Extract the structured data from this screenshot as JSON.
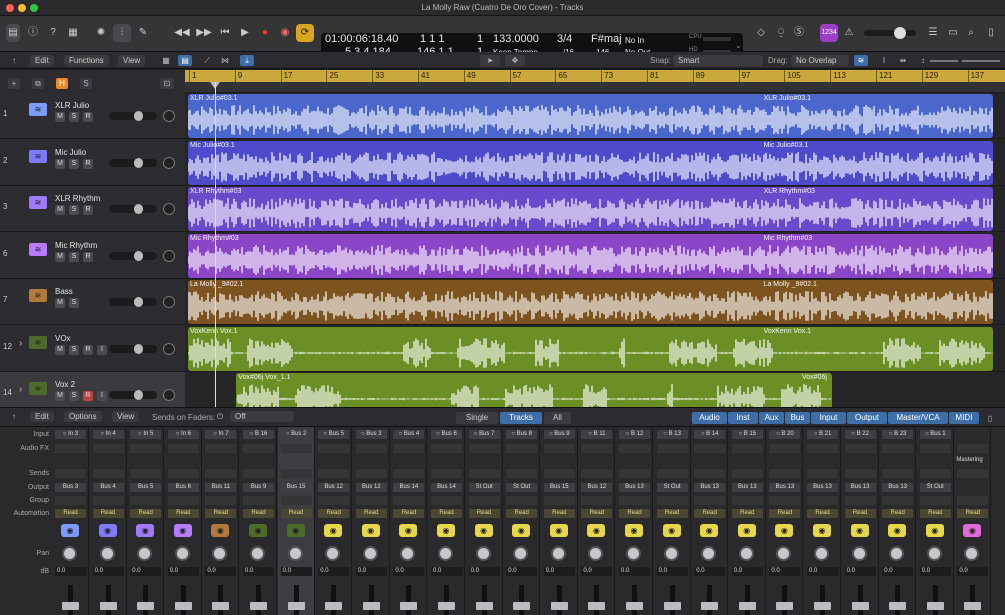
{
  "window": {
    "title": "La Molly Raw (Cuatro De Oro Cover) - Tracks"
  },
  "lcd": {
    "time": "01:00:06:18.40",
    "time_bars": "1  1  1",
    "time_sub": "1",
    "position": "5  3  4  184",
    "bars": "146  1  1",
    "bars_sub": "1",
    "tempo": "133.0000",
    "tempo_mode": "Keep Tempo",
    "signature": "3/4",
    "division": "/16",
    "key": "F#maj",
    "key_num": "146",
    "in": "No In",
    "out": "No Out",
    "cpu": "CPU",
    "hd": "HD"
  },
  "control": {
    "count_in": "1234"
  },
  "trackbar": {
    "edit": "Edit",
    "functions": "Functions",
    "view": "View",
    "snap_label": "Snap:",
    "snap": "Smart",
    "drag_label": "Drag:",
    "drag": "No Overlap"
  },
  "ruler": [
    "1",
    "9",
    "17",
    "25",
    "33",
    "41",
    "49",
    "57",
    "65",
    "73",
    "81",
    "89",
    "97",
    "105",
    "113",
    "121",
    "129",
    "137"
  ],
  "tracks": [
    {
      "num": "1",
      "name": "XLR Julio",
      "color": "#4b66cc",
      "icon": "#7a9aff",
      "m": "M",
      "s": "S",
      "r": "R",
      "i": "",
      "slider": 0.62,
      "regions": [
        {
          "name": "XLR Julio#03.1",
          "start": 0,
          "end": 1,
          "tail": "XLR Julio#03.1"
        }
      ]
    },
    {
      "num": "2",
      "name": "Mic Julio",
      "color": "#4d4bcc",
      "icon": "#7f79ff",
      "m": "M",
      "s": "S",
      "r": "R",
      "i": "",
      "slider": 0.62,
      "regions": [
        {
          "name": "Mic Julio#03.1",
          "start": 0,
          "end": 1,
          "tail": "Mic Julio#03.1"
        }
      ]
    },
    {
      "num": "3",
      "name": "XLR Rhythm",
      "color": "#6b49cc",
      "icon": "#9f7aff",
      "m": "M",
      "s": "S",
      "r": "R",
      "i": "",
      "slider": 0.62,
      "regions": [
        {
          "name": "XLR Rhythm#03",
          "start": 0,
          "end": 1,
          "tail": "XLR Rhythm#03"
        }
      ]
    },
    {
      "num": "6",
      "name": "Mic Rhythm",
      "color": "#8a45c9",
      "icon": "#b87aff",
      "m": "M",
      "s": "S",
      "r": "R",
      "i": "",
      "slider": 0.62,
      "regions": [
        {
          "name": "Mic Rhythm#03",
          "start": 0,
          "end": 1,
          "tail": "Mic Rhythm#03"
        }
      ]
    },
    {
      "num": "7",
      "name": "Bass",
      "color": "#7d5420",
      "icon": "#b07a3a",
      "m": "M",
      "s": "S",
      "r": "",
      "i": "",
      "slider": 0.62,
      "regions": [
        {
          "name": "La Molly _9#02.1",
          "start": 0,
          "end": 1,
          "tail": "La Molly _9#02.1"
        }
      ]
    },
    {
      "num": "12",
      "name": "VOx",
      "color": "#6b8f25",
      "icon": "#4d6b2a",
      "m": "M",
      "s": "S",
      "r": "R",
      "i": "I",
      "slider": 0.62,
      "folder": true,
      "regions": [
        {
          "name": "VoxKenn Vox.1",
          "start": 0,
          "end": 1,
          "tail": "VoxKenn Vox.1"
        }
      ]
    },
    {
      "num": "14",
      "name": "Vox 2",
      "color": "#6b8f25",
      "icon": "#4d6b2a",
      "m": "M",
      "s": "S",
      "r": "R",
      "i": "I",
      "slider": 0.62,
      "folder": true,
      "selected": true,
      "regions": [
        {
          "name": "Vox#06j Vox_1.1",
          "start": 0.06,
          "end": 0.8,
          "tail": "Vox#06j"
        }
      ]
    }
  ],
  "mixerbar": {
    "edit": "Edit",
    "options": "Options",
    "view": "View",
    "sends_on_faders": "Sends on Faders:",
    "sends_value": "Off",
    "modes": [
      "Single",
      "Tracks",
      "All"
    ],
    "active_mode": "Tracks",
    "filters": [
      "Audio",
      "Inst",
      "Aux",
      "Bus",
      "Input",
      "Output",
      "Master/VCA",
      "MIDI"
    ]
  },
  "mixer": {
    "row_labels": [
      "Input",
      "Audio FX",
      "Sends",
      "Output",
      "Group",
      "Automation",
      "Pan",
      "dB"
    ],
    "strips": [
      {
        "input": "In 3",
        "output": "Bus 3",
        "auto": "Read",
        "icon": "#7a9aff",
        "db": "0.0"
      },
      {
        "input": "In 4",
        "output": "Bus 4",
        "auto": "Read",
        "icon": "#7f79ff",
        "db": "0.0"
      },
      {
        "input": "In 5",
        "output": "Bus 5",
        "auto": "Read",
        "icon": "#9f7aff",
        "db": "0.0"
      },
      {
        "input": "In 6",
        "output": "Bus 6",
        "auto": "Read",
        "icon": "#b87aff",
        "db": "0.0"
      },
      {
        "input": "In 7",
        "output": "Bus 11",
        "auto": "Read",
        "icon": "#b07a3a",
        "db": "0.0"
      },
      {
        "input": "B 16",
        "output": "Bus 9",
        "auto": "Read",
        "icon": "#4d6b2a",
        "db": "0.0"
      },
      {
        "input": "Bus 2",
        "output": "Bus 15",
        "auto": "Read",
        "icon": "#4d6b2a",
        "db": "0.0",
        "selected": true
      },
      {
        "input": "Bus 5",
        "output": "Bus 12",
        "auto": "Read",
        "icon": "#e6d84a",
        "db": "0.0"
      },
      {
        "input": "Bus 3",
        "output": "Bus 12",
        "auto": "Read",
        "icon": "#e6d84a",
        "db": "0.0"
      },
      {
        "input": "Bus 4",
        "output": "Bus 14",
        "auto": "Read",
        "icon": "#e6d84a",
        "db": "0.0"
      },
      {
        "input": "Bus 6",
        "output": "Bus 14",
        "auto": "Read",
        "icon": "#e6d84a",
        "db": "0.0"
      },
      {
        "input": "Bus 7",
        "output": "St Out",
        "auto": "Read",
        "icon": "#e6d84a",
        "db": "0.0"
      },
      {
        "input": "Bus 8",
        "output": "St Out",
        "auto": "Read",
        "icon": "#e6d84a",
        "db": "0.0"
      },
      {
        "input": "Bus 9",
        "output": "Bus 15",
        "auto": "Read",
        "icon": "#e6d84a",
        "db": "0.0"
      },
      {
        "input": "B 11",
        "output": "Bus 12",
        "auto": "Read",
        "icon": "#e6d84a",
        "db": "0.0"
      },
      {
        "input": "B 12",
        "output": "Bus 13",
        "auto": "Read",
        "icon": "#e6d84a",
        "db": "0.0"
      },
      {
        "input": "B 13",
        "output": "St Out",
        "auto": "Read",
        "icon": "#e6d84a",
        "db": "0.0"
      },
      {
        "input": "B 14",
        "output": "Bus 13",
        "auto": "Read",
        "icon": "#e6d84a",
        "db": "0.0"
      },
      {
        "input": "B 15",
        "output": "Bus 13",
        "auto": "Read",
        "icon": "#e6d84a",
        "db": "0.0"
      },
      {
        "input": "B 20",
        "output": "Bus 13",
        "auto": "Read",
        "icon": "#e6d84a",
        "db": "0.0"
      },
      {
        "input": "B 21",
        "output": "Bus 13",
        "auto": "Read",
        "icon": "#e6d84a",
        "db": "0.0"
      },
      {
        "input": "B 22",
        "output": "Bus 13",
        "auto": "Read",
        "icon": "#e6d84a",
        "db": "0.0"
      },
      {
        "input": "B 23",
        "output": "Bus 13",
        "auto": "Read",
        "icon": "#e6d84a",
        "db": "0.0"
      },
      {
        "input": "Bus 1",
        "output": "St Out",
        "auto": "Read",
        "icon": "#e6d84a",
        "db": "0.0"
      },
      {
        "input": "",
        "output": "",
        "auto": "Read",
        "icon": "#e06bd6",
        "db": "0.0",
        "special": "Mastering"
      }
    ]
  },
  "colors": {
    "ruler": "#c9a83c",
    "accent": "#4a8fe0"
  }
}
